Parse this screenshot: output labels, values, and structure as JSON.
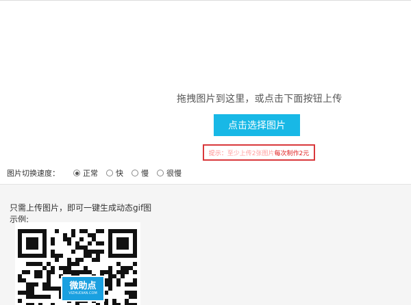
{
  "upload": {
    "hint": "拖拽图片到这里，或点击下面按钮上传",
    "button_label": "点击选择图片"
  },
  "tip": {
    "label": "提示：",
    "body": "至少上传2张图片 ",
    "price": "每次制作2元"
  },
  "speed": {
    "label": "图片切换速度：",
    "options": [
      {
        "label": "正常",
        "checked": true
      },
      {
        "label": "快",
        "checked": false
      },
      {
        "label": "慢",
        "checked": false
      },
      {
        "label": "很慢",
        "checked": false
      }
    ]
  },
  "example": {
    "description": "只需上传图片，即可一键生成动态gif图",
    "label": "示例:",
    "logo_text": "微助点",
    "logo_url": "VIZHUDIAN.COM"
  },
  "colors": {
    "accent": "#18b8e6",
    "tip_border": "#d9373a",
    "price_text": "#e02020",
    "panel_bg": "#f5f5f5"
  }
}
